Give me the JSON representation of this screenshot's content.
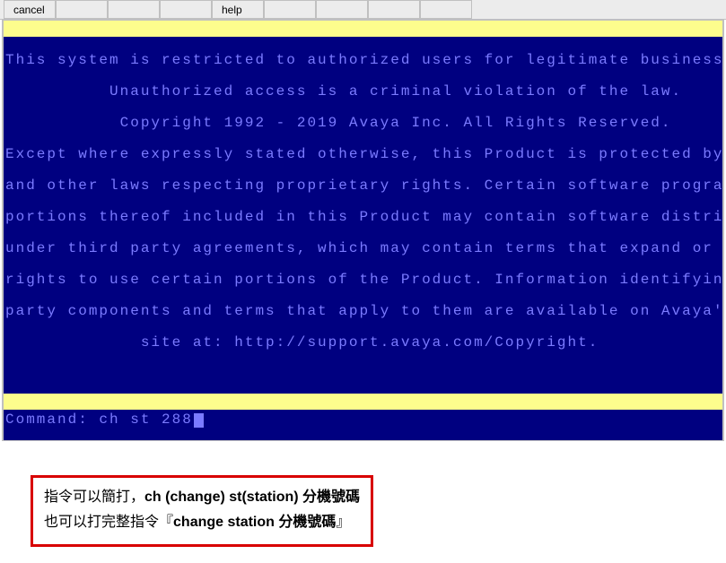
{
  "menubar": {
    "items": [
      {
        "label": "cancel",
        "visible": true
      },
      {
        "label": "",
        "visible": false
      },
      {
        "label": "",
        "visible": false
      },
      {
        "label": "",
        "visible": false
      },
      {
        "label": "help",
        "visible": true
      },
      {
        "label": "",
        "visible": false
      },
      {
        "label": "",
        "visible": false
      },
      {
        "label": "",
        "visible": false
      },
      {
        "label": "",
        "visible": false
      }
    ]
  },
  "terminal": {
    "lines": [
      "This system is restricted to authorized users for legitimate business purposes.",
      "          Unauthorized access is a criminal violation of the law.",
      "           Copyright 1992 - 2019 Avaya Inc. All Rights Reserved.",
      "Except where expressly stated otherwise, this Product is protected by copyright",
      "and other laws respecting proprietary rights. Certain software programs or",
      "portions thereof included in this Product may contain software distributed",
      "under third party agreements, which may contain terms that expand or limit",
      "rights to use certain portions of the Product. Information identifying third",
      "party components and terms that apply to them are available on Avaya's web",
      "             site at: http://support.avaya.com/Copyright."
    ]
  },
  "command": {
    "prompt": "Command:",
    "value": "ch st 288"
  },
  "annotation": {
    "line1_a": "指令可以簡打，",
    "line1_b": "ch (change) st(station) 分機號碼",
    "line2_a": "也可以打完整指令『",
    "line2_b": "change station 分機號碼",
    "line2_c": "』"
  }
}
